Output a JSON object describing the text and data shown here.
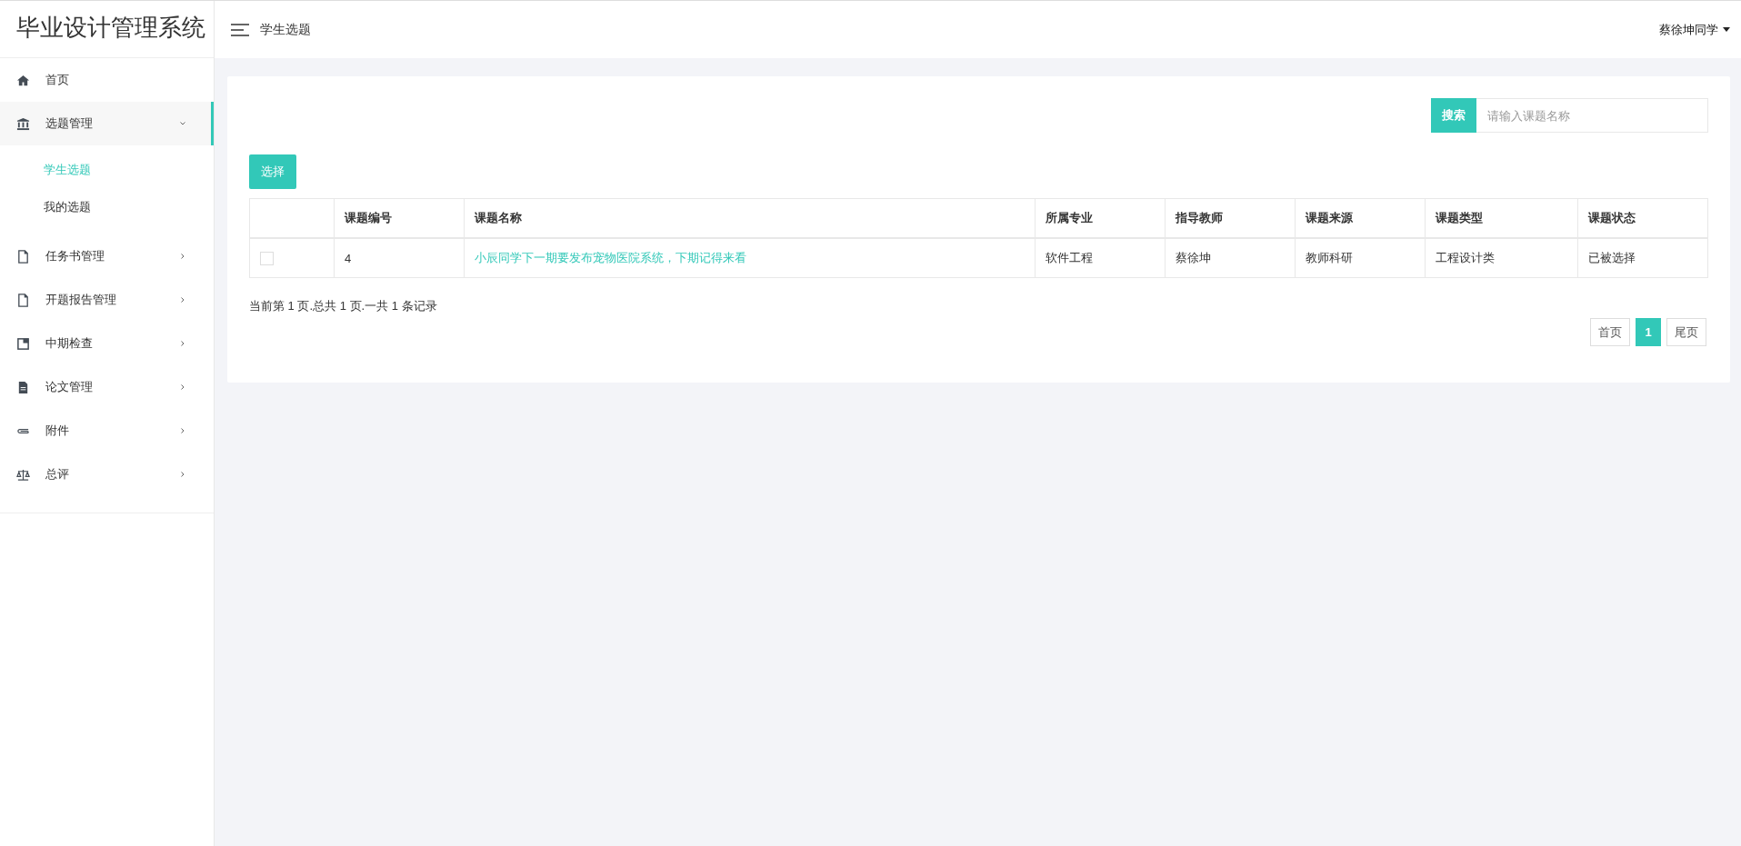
{
  "app_title": "毕业设计管理系统",
  "header": {
    "breadcrumb": "学生选题",
    "user": "蔡徐坤同学"
  },
  "sidebar": {
    "items": [
      {
        "label": "首页",
        "kind": "link"
      },
      {
        "label": "选题管理",
        "kind": "menu",
        "expanded": true,
        "children": [
          {
            "label": "学生选题",
            "selected": true
          },
          {
            "label": "我的选题",
            "selected": false
          }
        ]
      },
      {
        "label": "任务书管理",
        "kind": "menu",
        "expanded": false
      },
      {
        "label": "开题报告管理",
        "kind": "menu",
        "expanded": false
      },
      {
        "label": "中期检查",
        "kind": "menu",
        "expanded": false
      },
      {
        "label": "论文管理",
        "kind": "menu",
        "expanded": false
      },
      {
        "label": "附件",
        "kind": "menu",
        "expanded": false
      },
      {
        "label": "总评",
        "kind": "menu",
        "expanded": false
      }
    ]
  },
  "search": {
    "button": "搜索",
    "placeholder": "请输入课题名称"
  },
  "select_button": "选择",
  "table": {
    "columns": [
      "课题编号",
      "课题名称",
      "所属专业",
      "指导教师",
      "课题来源",
      "课题类型",
      "课题状态"
    ],
    "rows": [
      {
        "checked": false,
        "cells": [
          "4",
          "小辰同学下一期要发布宠物医院系统，下期记得来看",
          "软件工程",
          "蔡徐坤",
          "教师科研",
          "工程设计类",
          "已被选择"
        ]
      }
    ]
  },
  "summary": "当前第 1 页.总共 1 页.一共 1 条记录",
  "pagination": {
    "first": "首页",
    "pages": [
      {
        "label": "1",
        "selected": true
      }
    ],
    "last": "尾页"
  }
}
